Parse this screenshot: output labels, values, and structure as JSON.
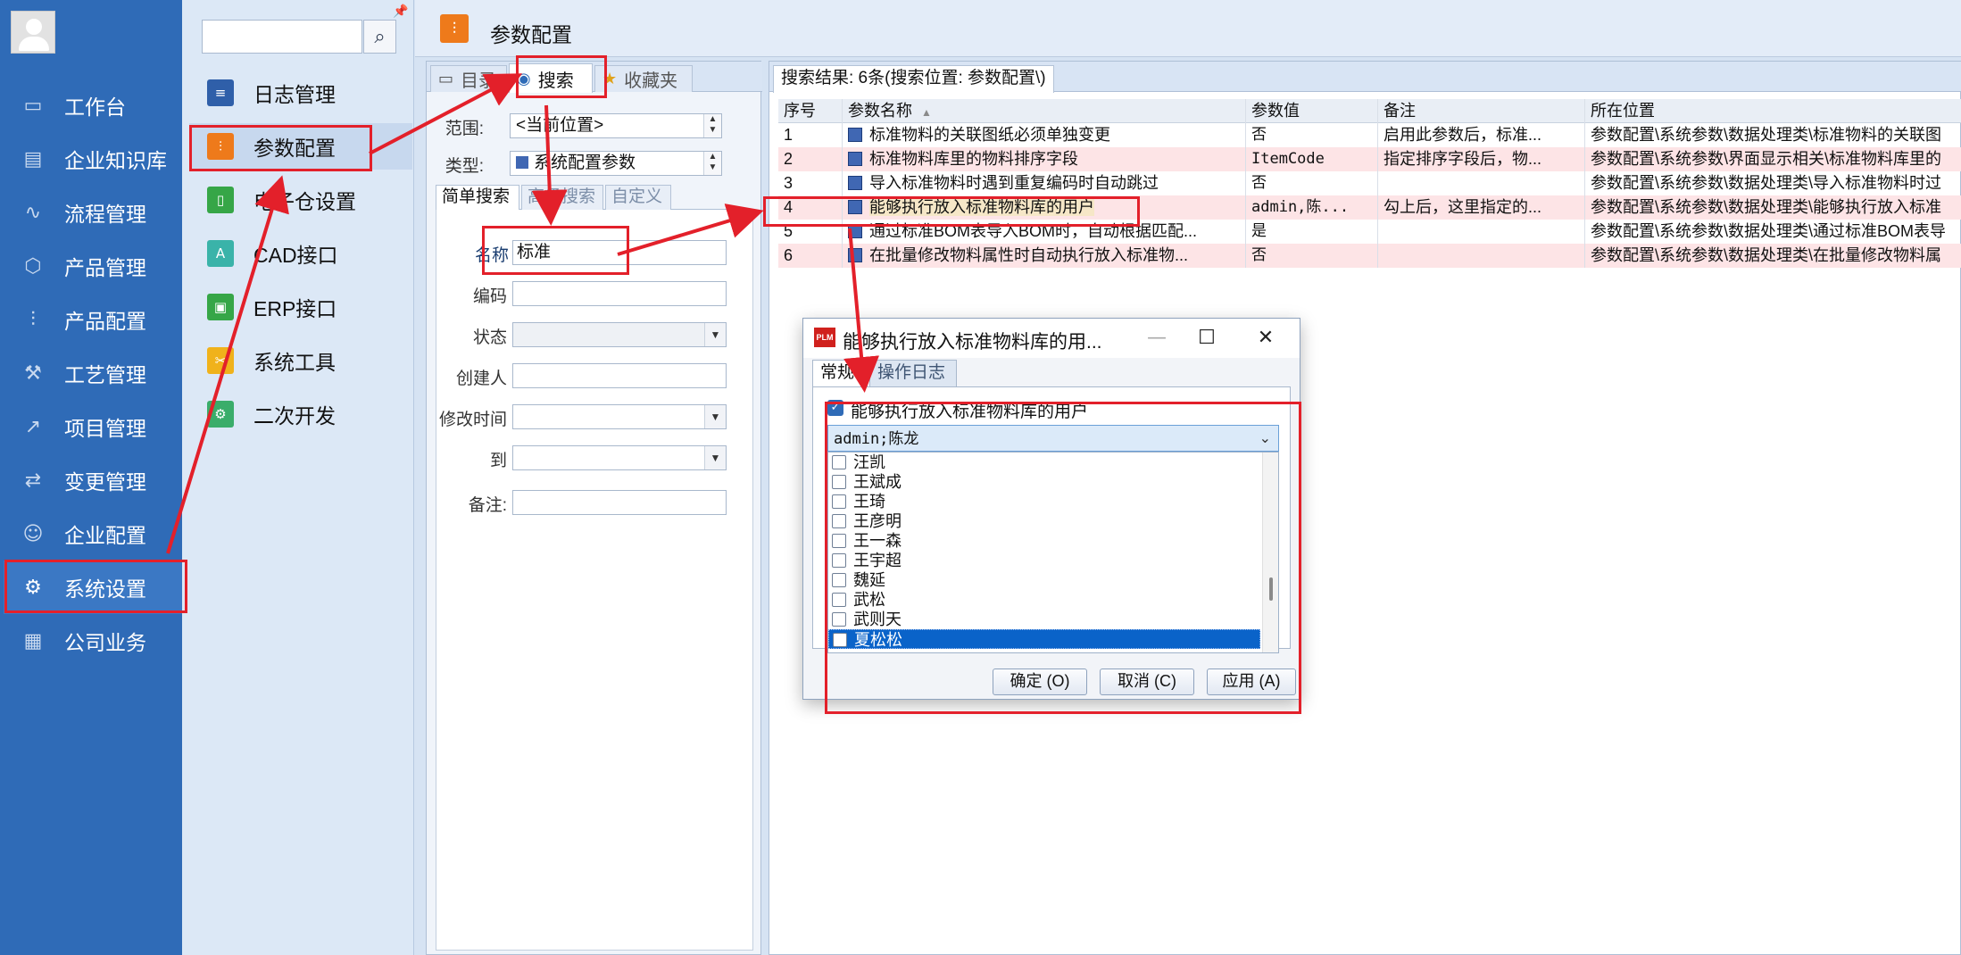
{
  "colors": {
    "sidebar": "#2f6bb7",
    "accent_orange": "#ee7a1b",
    "annotation_red": "#e3202a",
    "row_pink": "#fde4e6",
    "selection_blue": "#0a63c9"
  },
  "leftnav": {
    "items": [
      {
        "label": "工作台",
        "icon": "monitor-icon"
      },
      {
        "label": "企业知识库",
        "icon": "book-icon"
      },
      {
        "label": "流程管理",
        "icon": "flow-icon"
      },
      {
        "label": "产品管理",
        "icon": "cube-icon"
      },
      {
        "label": "产品配置",
        "icon": "sliders-icon"
      },
      {
        "label": "工艺管理",
        "icon": "wrench-icon"
      },
      {
        "label": "项目管理",
        "icon": "chart-icon"
      },
      {
        "label": "变更管理",
        "icon": "change-icon"
      },
      {
        "label": "企业配置",
        "icon": "users-icon"
      },
      {
        "label": "系统设置",
        "icon": "gear-icon"
      },
      {
        "label": "公司业务",
        "icon": "grid-icon"
      }
    ],
    "active": "系统设置"
  },
  "subnav": {
    "search_placeholder": "",
    "items": [
      {
        "label": "日志管理",
        "icon": "log-icon",
        "color": "#2f5fa9"
      },
      {
        "label": "参数配置",
        "icon": "sliders-icon",
        "color": "#ee7a1b"
      },
      {
        "label": "电子仓设置",
        "icon": "tablet-icon",
        "color": "#36a647"
      },
      {
        "label": "CAD接口",
        "icon": "cad-icon",
        "color": "#3ab3a9"
      },
      {
        "label": "ERP接口",
        "icon": "erp-icon",
        "color": "#36a647"
      },
      {
        "label": "系统工具",
        "icon": "tools-icon",
        "color": "#f0b21b"
      },
      {
        "label": "二次开发",
        "icon": "dev-icon",
        "color": "#3aad6a"
      }
    ],
    "active": "参数配置"
  },
  "main": {
    "title": "参数配置",
    "search_panel": {
      "tabs": [
        {
          "label": "目录",
          "icon": "monitor-icon"
        },
        {
          "label": "搜索",
          "icon": "globe-search-icon"
        },
        {
          "label": "收藏夹",
          "icon": "folder-star-icon"
        }
      ],
      "active_tab": "搜索",
      "scope_label": "范围:",
      "scope_value": "<当前位置>",
      "type_label": "类型:",
      "type_value": "系统配置参数",
      "inner_tabs": [
        "简单搜索",
        "高级搜索",
        "自定义"
      ],
      "fields": {
        "name_label": "名称",
        "name_value": "标准",
        "code_label": "编码",
        "status_label": "状态",
        "creator_label": "创建人",
        "modified_label": "修改时间",
        "to_label": "到",
        "remark_label": "备注:"
      }
    },
    "results": {
      "tab_label": "搜索结果: 6条(搜索位置: 参数配置\\)",
      "columns": [
        "序号",
        "参数名称",
        "参数值",
        "备注",
        "所在位置"
      ],
      "rows": [
        {
          "no": "1",
          "name": "标准物料的关联图纸必须单独变更",
          "value": "否",
          "remark": "启用此参数后，标准...",
          "location": "参数配置\\系统参数\\数据处理类\\标准物料的关联图"
        },
        {
          "no": "2",
          "name": "标准物料库里的物料排序字段",
          "value": "ItemCode",
          "remark": "指定排序字段后，物...",
          "location": "参数配置\\系统参数\\界面显示相关\\标准物料库里的"
        },
        {
          "no": "3",
          "name": "导入标准物料时遇到重复编码时自动跳过",
          "value": "否",
          "remark": "",
          "location": "参数配置\\系统参数\\数据处理类\\导入标准物料时过"
        },
        {
          "no": "4",
          "name": "能够执行放入标准物料库的用户",
          "value": "admin,陈...",
          "remark": "勾上后，这里指定的...",
          "location": "参数配置\\系统参数\\数据处理类\\能够执行放入标准"
        },
        {
          "no": "5",
          "name": "通过标准BOM表导入BOM时，自动根据匹配...",
          "value": "是",
          "remark": "",
          "location": "参数配置\\系统参数\\数据处理类\\通过标准BOM表导"
        },
        {
          "no": "6",
          "name": "在批量修改物料属性时自动执行放入标准物...",
          "value": "否",
          "remark": "",
          "location": "参数配置\\系统参数\\数据处理类\\在批量修改物料属"
        }
      ]
    }
  },
  "dialog": {
    "logo_text": "PLM",
    "title": "能够执行放入标准物料库的用...",
    "tabs": [
      "常规",
      "操作日志"
    ],
    "checkbox_label": "能够执行放入标准物料库的用户",
    "combo_value": "admin;陈龙",
    "users": [
      "汪凯",
      "王斌成",
      "王琦",
      "王彦明",
      "王一森",
      "王宇超",
      "魏延",
      "武松",
      "武则天",
      "夏松松"
    ],
    "selected_user": "夏松松",
    "ok_label": "确定 (O)",
    "cancel_label": "取消 (C)",
    "apply_label": "应用 (A)"
  }
}
